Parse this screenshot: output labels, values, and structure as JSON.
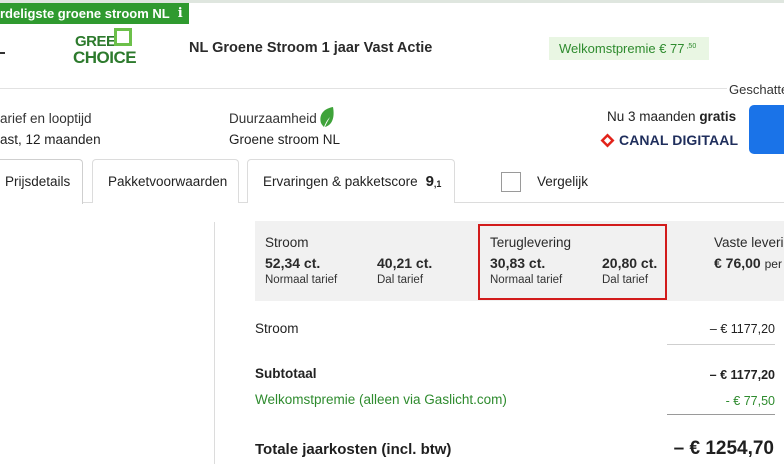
{
  "badge": {
    "text": "rdeligste groene stroom NL",
    "info_icon": "info-icon"
  },
  "supplier": {
    "logo_line1": "GREEN",
    "logo_line2": "CHOICE",
    "logo_colors": {
      "text": "#2d7a2d",
      "square": "#6cc04a"
    }
  },
  "product": {
    "title": "NL Groene Stroom 1 jaar Vast Actie",
    "welcome_bonus_label": "Welkomstpremie € 77",
    "welcome_bonus_cents": ",50"
  },
  "estimate_label": "Geschatte",
  "contract": {
    "label": "arief en looptijd",
    "value": "ast, 12 maanden"
  },
  "sustainability": {
    "label": "Duurzaamheid",
    "value": "Groene stroom NL",
    "icon": "leaf-icon"
  },
  "promo": {
    "text_prefix": "Nu 3 maanden ",
    "text_bold": "gratis",
    "brand": "CANAL DIGITAAL",
    "brand_icon": "canal-digitaal-logo"
  },
  "tabs": [
    {
      "label": "Prijsdetails",
      "active": true
    },
    {
      "label": "Pakketvoorwaarden",
      "active": false
    },
    {
      "label": "Ervaringen & pakketscore",
      "active": false,
      "score": "9",
      "score_decimal": ",1"
    }
  ],
  "compare": {
    "label": "Vergelijk",
    "checked": false
  },
  "tariffs": {
    "stroom": {
      "title": "Stroom",
      "normal_value": "52,34 ct.",
      "normal_label": "Normaal tarief",
      "dal_value": "40,21 ct.",
      "dal_label": "Dal tarief"
    },
    "teruglevering": {
      "title": "Teruglevering",
      "normal_value": "30,83 ct.",
      "normal_label": "Normaal tarief",
      "dal_value": "20,80 ct.",
      "dal_label": "Dal tarief"
    },
    "vaste": {
      "title": "Vaste levering",
      "value": "€ 76,00",
      "suffix": "per"
    }
  },
  "costs": {
    "stroom_label": "Stroom",
    "stroom_value": "– € 1177,20",
    "subtotal_label": "Subtotaal",
    "subtotal_value": "– € 1177,20",
    "welcome_label": "Welkomstpremie (alleen via Gaslicht.com)",
    "welcome_value": "- € 77,50",
    "total_label": "Totale jaarkosten (incl. btw)",
    "total_value": "– € 1254,70"
  },
  "colors": {
    "brand_green": "#2f9a2f",
    "highlight_red": "#d21b1b",
    "action_blue": "#1a73e8"
  }
}
